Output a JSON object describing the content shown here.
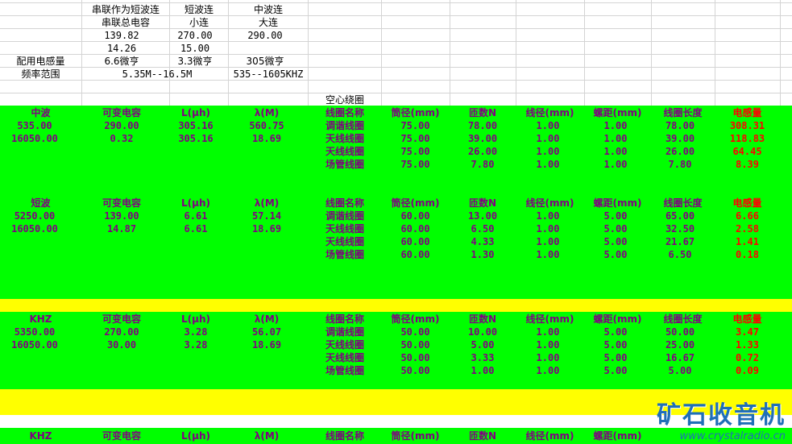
{
  "top": {
    "col_heads": [
      {
        "l1": "串联作为短波连",
        "l2": "串联总电容"
      },
      {
        "l1": "短波连",
        "l2": "小连"
      },
      {
        "l1": "中波连",
        "l2": "大连"
      }
    ],
    "row3": [
      "139.82",
      "270.00",
      "290.00"
    ],
    "row4": [
      "14.26",
      "15.00"
    ],
    "row5_label": "配用电感量",
    "row5": [
      "6.6微亨",
      "3.3微亨",
      "305微亨"
    ],
    "row6_label": "频率范围",
    "row6": [
      "5.35M--16.5M",
      "535--1605KHZ"
    ],
    "air_coil": "空心绕圈"
  },
  "header_labels": {
    "var_cap": "可变电容",
    "L": "L(μh)",
    "lambda": "λ(M)",
    "coil_name": "线圈名称",
    "tube_dia": "筒径(mm)",
    "turns": "匝数N",
    "wire_dia": "线径(mm)",
    "pitch": "螺距(mm)",
    "coil_len": "线圈长度",
    "inductance": "电感量"
  },
  "sections": [
    {
      "band": "中波",
      "rows": [
        {
          "freq": "535.00",
          "cap": "290.00",
          "L": "305.16",
          "lam": "560.75"
        },
        {
          "freq": "16050.00",
          "cap": "0.32",
          "L": "305.16",
          "lam": "18.69"
        }
      ],
      "coils": [
        {
          "name": "调谐线圈",
          "dia": "75.00",
          "n": "78.00",
          "wire": "1.00",
          "pitch": "1.00",
          "len": "78.00",
          "ind": "308.31"
        },
        {
          "name": "天线线圈",
          "dia": "75.00",
          "n": "39.00",
          "wire": "1.00",
          "pitch": "1.00",
          "len": "39.00",
          "ind": "118.83"
        },
        {
          "name": "天线线圈",
          "dia": "75.00",
          "n": "26.00",
          "wire": "1.00",
          "pitch": "1.00",
          "len": "26.00",
          "ind": "64.45"
        },
        {
          "name": "场管线圈",
          "dia": "75.00",
          "n": "7.80",
          "wire": "1.00",
          "pitch": "1.00",
          "len": "7.80",
          "ind": "8.39"
        }
      ]
    },
    {
      "band": "短波",
      "rows": [
        {
          "freq": "5250.00",
          "cap": "139.00",
          "L": "6.61",
          "lam": "57.14"
        },
        {
          "freq": "16050.00",
          "cap": "14.87",
          "L": "6.61",
          "lam": "18.69"
        }
      ],
      "coils": [
        {
          "name": "调谐线圈",
          "dia": "60.00",
          "n": "13.00",
          "wire": "1.00",
          "pitch": "5.00",
          "len": "65.00",
          "ind": "6.66"
        },
        {
          "name": "天线线圈",
          "dia": "60.00",
          "n": "6.50",
          "wire": "1.00",
          "pitch": "5.00",
          "len": "32.50",
          "ind": "2.58"
        },
        {
          "name": "天线线圈",
          "dia": "60.00",
          "n": "4.33",
          "wire": "1.00",
          "pitch": "5.00",
          "len": "21.67",
          "ind": "1.41"
        },
        {
          "name": "场管线圈",
          "dia": "60.00",
          "n": "1.30",
          "wire": "1.00",
          "pitch": "5.00",
          "len": "6.50",
          "ind": "0.18"
        }
      ]
    },
    {
      "band": "KHZ",
      "rows": [
        {
          "freq": "5350.00",
          "cap": "270.00",
          "L": "3.28",
          "lam": "56.07"
        },
        {
          "freq": "16050.00",
          "cap": "30.00",
          "L": "3.28",
          "lam": "18.69"
        }
      ],
      "coils": [
        {
          "name": "调谐线圈",
          "dia": "50.00",
          "n": "10.00",
          "wire": "1.00",
          "pitch": "5.00",
          "len": "50.00",
          "ind": "3.47"
        },
        {
          "name": "天线线圈",
          "dia": "50.00",
          "n": "5.00",
          "wire": "1.00",
          "pitch": "5.00",
          "len": "25.00",
          "ind": "1.33"
        },
        {
          "name": "天线线圈",
          "dia": "50.00",
          "n": "3.33",
          "wire": "1.00",
          "pitch": "5.00",
          "len": "16.67",
          "ind": "0.72"
        },
        {
          "name": "场管线圈",
          "dia": "50.00",
          "n": "1.00",
          "wire": "1.00",
          "pitch": "5.00",
          "len": "5.00",
          "ind": "0.09"
        }
      ]
    },
    {
      "band": "KHZ",
      "rows": [],
      "coils": []
    }
  ],
  "watermark": {
    "logo": "矿石收音机",
    "url": "www.crystalradio.cn"
  },
  "colors": {
    "green": "#00ff00",
    "yellow": "#ffff00",
    "purple": "#800080",
    "red": "#ff0000",
    "grid": "#d4d4d4"
  }
}
